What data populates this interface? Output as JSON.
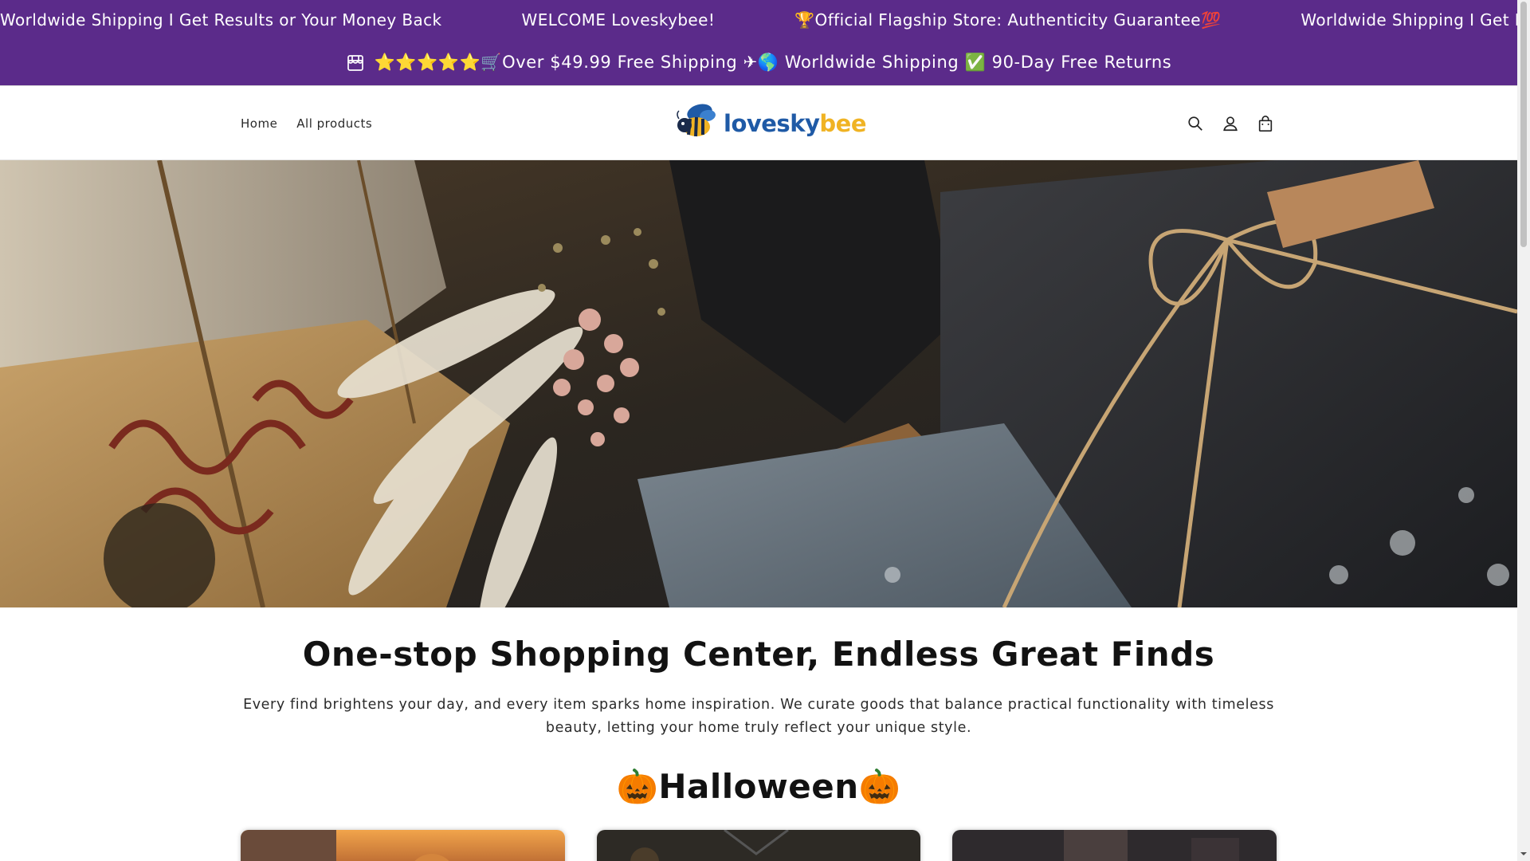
{
  "marquee": {
    "items": [
      "Worldwide Shipping I Get Results or Your Money Back",
      "WELCOME Loveskybee!",
      "🏆Official Flagship Store: Authenticity Guarantee💯",
      "Worldwide Shipping I Get Results or Your Money Back"
    ],
    "color": "#5b2b8a"
  },
  "announcement": {
    "icon": "store-icon",
    "text": "⭐⭐⭐⭐⭐🛒Over $49.99 Free Shipping ✈🌎 Worldwide Shipping ✅ 90-Day Free Returns"
  },
  "header": {
    "nav": [
      "Home",
      "All products"
    ],
    "logo": {
      "part1": "lovesky",
      "part2": "bee"
    },
    "icons": [
      "search-icon",
      "account-icon",
      "cart-icon"
    ]
  },
  "intro": {
    "title": "One-stop Shopping Center, Endless Great Finds",
    "text": "Every find brightens your day, and every item sparks home inspiration. We curate goods that balance practical functionality with timeless beauty, letting your home truly reflect your unique style."
  },
  "collection": {
    "title": "🎃Halloween🎃"
  }
}
